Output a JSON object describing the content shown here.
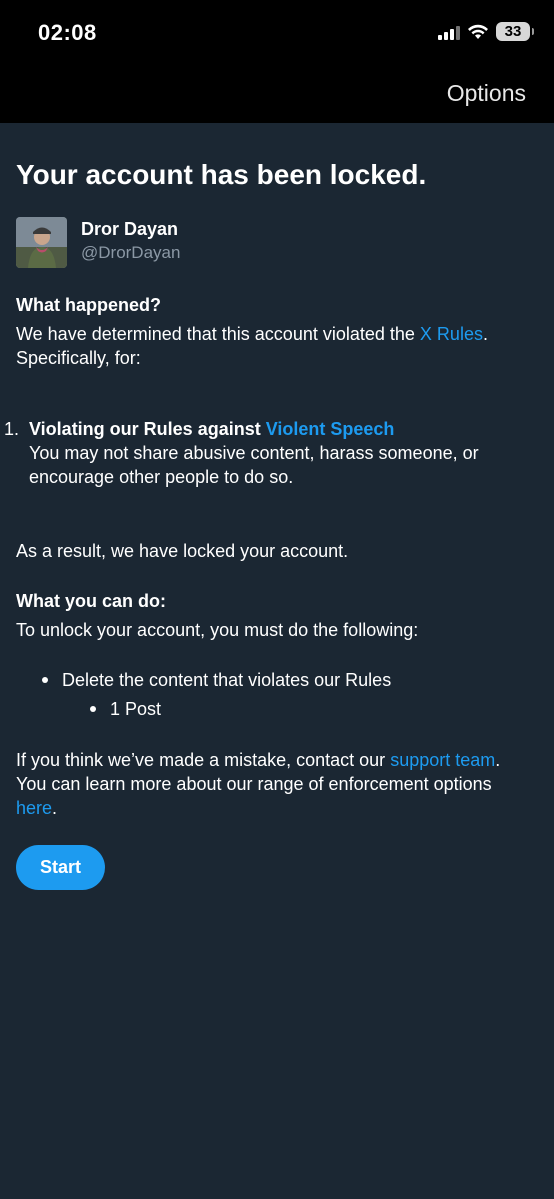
{
  "status_bar": {
    "time": "02:08",
    "battery": "33"
  },
  "header": {
    "options_label": "Options"
  },
  "title": "Your account has been locked.",
  "user": {
    "name": "Dror Dayan",
    "handle": "@DrorDayan"
  },
  "what_happened": {
    "heading": "What happened?",
    "text_before": "We have determined that this account violated the ",
    "rules_link": "X Rules",
    "text_after": ".",
    "specifically": "Specifically, for:"
  },
  "violations": [
    {
      "number": "1.",
      "title_prefix": "Violating our Rules against ",
      "title_link": "Violent Speech",
      "description": "You may not share abusive content, harass someone, or encourage other people to do so."
    }
  ],
  "result_text": "As a result, we have locked your account.",
  "what_you_can_do": {
    "heading": "What you can do:",
    "text": "To unlock your account, you must do the following:",
    "steps": [
      {
        "label": "Delete the content that violates our Rules",
        "sub_items": [
          "1 Post"
        ]
      }
    ]
  },
  "footer": {
    "mistake_text": "If you think we’ve made a mistake, contact our ",
    "support_link": "support team",
    "period1": ".",
    "learn_text": "You can learn more about our range of enforcement options ",
    "here_link": "here",
    "period2": "."
  },
  "start_button": "Start",
  "colors": {
    "background": "#1b2733",
    "link": "#1d9bf0",
    "secondary_text": "#8b98a5",
    "status_bar": "#000000"
  }
}
